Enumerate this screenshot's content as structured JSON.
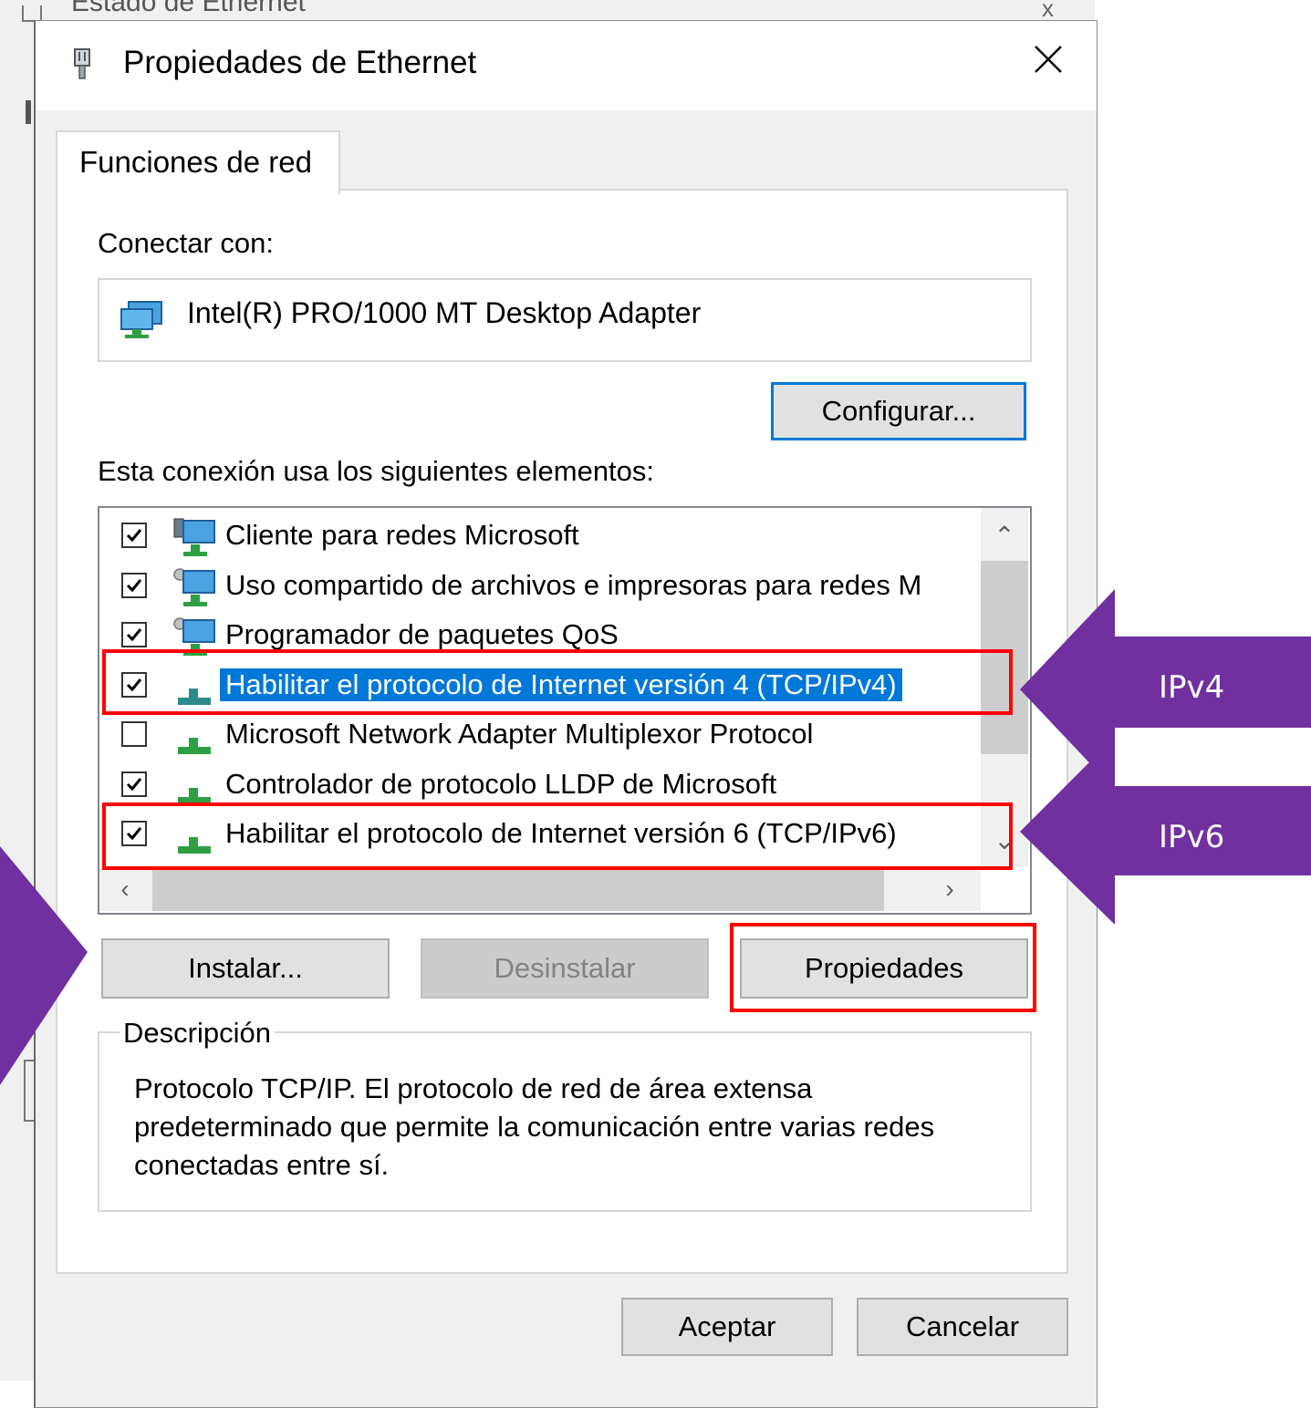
{
  "background_window": {
    "title": "Estado de Ethernet",
    "close": "x"
  },
  "dialog": {
    "title": "Propiedades de Ethernet",
    "close_label": "×",
    "tab": "Funciones de red",
    "connect_with_label": "Conectar con:",
    "adapter_name": "Intel(R) PRO/1000 MT Desktop Adapter",
    "configure_button": "Configurar...",
    "elements_label": "Esta conexión usa los siguientes elementos:",
    "items": [
      {
        "label": "Cliente para redes Microsoft",
        "checked": true,
        "icon": "network-client-icon"
      },
      {
        "label": "Uso compartido de archivos e impresoras para redes M",
        "checked": true,
        "icon": "file-sharing-icon"
      },
      {
        "label": "Programador de paquetes QoS",
        "checked": true,
        "icon": "qos-scheduler-icon"
      },
      {
        "label": "Habilitar el protocolo de Internet versión 4 (TCP/IPv4)",
        "checked": true,
        "selected": true,
        "icon": "protocol-icon"
      },
      {
        "label": "Microsoft Network Adapter Multiplexor Protocol",
        "checked": false,
        "icon": "protocol-icon"
      },
      {
        "label": "Controlador de protocolo LLDP de Microsoft",
        "checked": true,
        "icon": "protocol-icon"
      },
      {
        "label": "Habilitar el protocolo de Internet versión 6 (TCP/IPv6)",
        "checked": true,
        "icon": "protocol-icon"
      }
    ],
    "install_button": "Instalar...",
    "uninstall_button": "Desinstalar",
    "properties_button": "Propiedades",
    "description_title": "Descripción",
    "description_text": "Protocolo TCP/IP. El protocolo de red de área extensa predeterminado que permite la comunicación entre varias redes conectadas entre sí.",
    "ok_button": "Aceptar",
    "cancel_button": "Cancelar"
  },
  "annotations": {
    "ipv4_label": "IPv4",
    "ipv6_label": "IPv6",
    "arrow_color": "#7030a0",
    "highlight_color": "#ff0000"
  },
  "colors": {
    "selection": "#0078d7",
    "dialog_bg": "#f0f0f0"
  }
}
